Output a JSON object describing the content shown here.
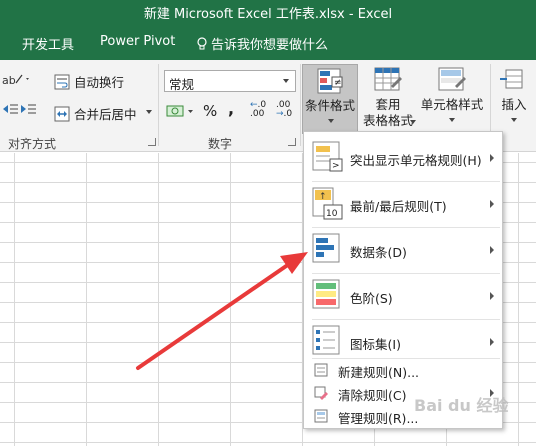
{
  "window": {
    "title": "新建 Microsoft Excel 工作表.xlsx  -  Excel"
  },
  "tabs": [
    {
      "label": "开发工具"
    },
    {
      "label": "Power Pivot"
    }
  ],
  "tell_me": "告诉我你想要做什么",
  "ribbon": {
    "alignment": {
      "label": "对齐方式",
      "wrap_text": "自动换行",
      "merge_center": "合并后居中"
    },
    "number": {
      "label": "数字",
      "format_value": "常规",
      "percent": "%",
      "comma": ",",
      "inc_decimal": ".00",
      "dec_decimal": ".0"
    },
    "styles": {
      "conditional_format": "条件格式",
      "table_format_1": "套用",
      "table_format_2": "表格格式",
      "cell_styles": "单元格样式"
    },
    "cells": {
      "insert": "插入"
    }
  },
  "menu": {
    "items": [
      {
        "label": "突出显示单元格规则(H)"
      },
      {
        "label": "最前/最后规则(T)"
      },
      {
        "label": "数据条(D)"
      },
      {
        "label": "色阶(S)"
      },
      {
        "label": "图标集(I)"
      }
    ],
    "small_items": [
      {
        "label": "新建规则(N)..."
      },
      {
        "label": "清除规则(C)"
      },
      {
        "label": "管理规则(R)..."
      }
    ]
  },
  "watermark": "Bai du 经验",
  "colors": {
    "brand": "#217346",
    "arrow": "#e83a3a"
  }
}
